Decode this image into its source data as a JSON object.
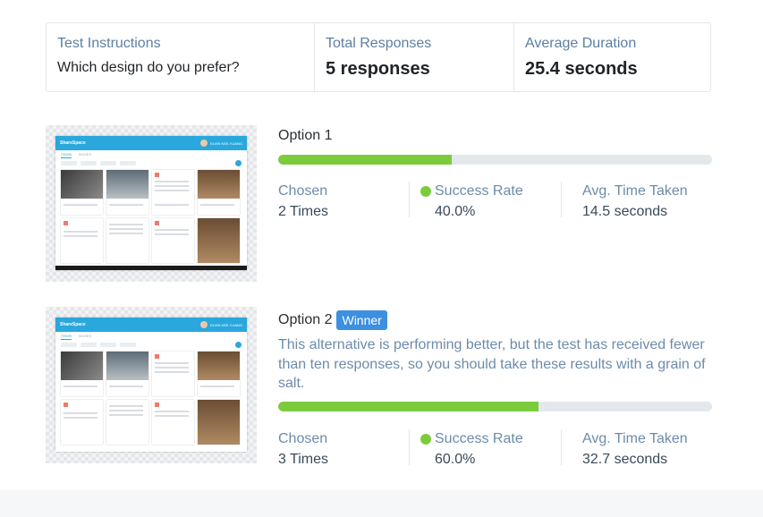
{
  "summary": {
    "instructions_label": "Test Instructions",
    "instructions_text": "Which design do you prefer?",
    "responses_label": "Total Responses",
    "responses_value": "5 responses",
    "duration_label": "Average Duration",
    "duration_value": "25.4 seconds"
  },
  "options": [
    {
      "title": "Option 1",
      "progress": 0.4,
      "chosen_label": "Chosen",
      "chosen_value": "2 Times",
      "success_label": "Success Rate",
      "success_value": "40.0%",
      "time_label": "Avg. Time Taken",
      "time_value": "14.5 seconds"
    },
    {
      "title": "Option 2",
      "badge": "Winner",
      "description": "This alternative is performing better, but the test has received fewer than ten responses, so you should take these results with a grain of salt.",
      "progress": 0.6,
      "chosen_label": "Chosen",
      "chosen_value": "3 Times",
      "success_label": "Success Rate",
      "success_value": "60.0%",
      "time_label": "Avg. Time Taken",
      "time_value": "32.7 seconds"
    }
  ],
  "colors": {
    "progress_fill": "#7ccb3d",
    "progress_track": "#e3e8ed",
    "badge": "#3d8fe0",
    "label_blue": "#6c8bab"
  },
  "icons": {
    "success_indicator": "green-dot-icon"
  }
}
